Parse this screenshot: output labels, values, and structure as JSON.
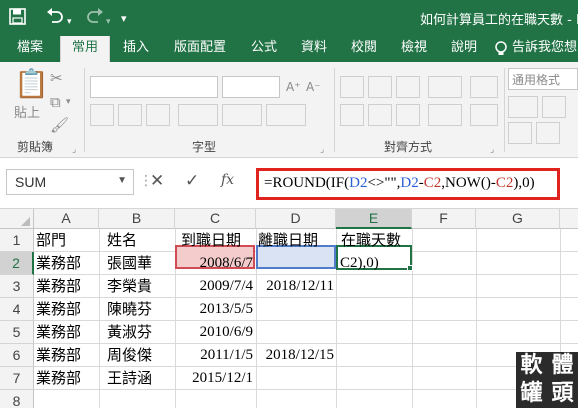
{
  "window": {
    "title": "如何計算員工的在職天數 - E",
    "save_icon": "save-icon",
    "undo_icon": "undo-icon",
    "redo_icon": "redo-icon",
    "customize_icon": "customize-quick-access-icon"
  },
  "ribbon_tabs": [
    {
      "label": "檔案"
    },
    {
      "label": "常用"
    },
    {
      "label": "插入"
    },
    {
      "label": "版面配置"
    },
    {
      "label": "公式"
    },
    {
      "label": "資料"
    },
    {
      "label": "校閱"
    },
    {
      "label": "檢視"
    },
    {
      "label": "說明"
    },
    {
      "label": "告訴我您想"
    }
  ],
  "ribbon": {
    "paste_label": "貼上",
    "groups": {
      "clipboard": "剪貼簿",
      "font": "字型",
      "alignment": "對齊方式"
    },
    "number_format": "通用格式"
  },
  "formula_bar": {
    "name_box": "SUM",
    "fx": "fx",
    "formula_parts": [
      {
        "text": "=ROUND(IF(",
        "color": "black"
      },
      {
        "text": "D2",
        "color": "blue"
      },
      {
        "text": "<>\"\",",
        "color": "black"
      },
      {
        "text": "D2",
        "color": "blue"
      },
      {
        "text": "-",
        "color": "black"
      },
      {
        "text": "C2",
        "color": "red"
      },
      {
        "text": ",NOW()-",
        "color": "black"
      },
      {
        "text": "C2",
        "color": "red"
      },
      {
        "text": "),0)",
        "color": "black"
      }
    ]
  },
  "grid": {
    "columns": [
      "A",
      "B",
      "C",
      "D",
      "E",
      "F",
      "G"
    ],
    "rows": [
      "1",
      "2",
      "3",
      "4",
      "5",
      "6",
      "7",
      "8"
    ],
    "active_column": "E",
    "active_row": "2",
    "cells": {
      "A1": "部門",
      "B1": "姓名",
      "C1": "到職日期",
      "D1": "離職日期",
      "E1": "在職天數",
      "A2": "業務部",
      "B2": "張國華",
      "C2": "2008/6/7",
      "E2": "C2),0)",
      "A3": "業務部",
      "B3": "李榮貴",
      "C3": "2009/7/4",
      "D3": "2018/12/11",
      "A4": "業務部",
      "B4": "陳曉芬",
      "C4": "2013/5/5",
      "A5": "業務部",
      "B5": "黃淑芬",
      "C5": "2010/6/9",
      "A6": "業務部",
      "B6": "周俊傑",
      "C6": "2011/1/5",
      "D6": "2018/12/15",
      "A7": "業務部",
      "B7": "王詩涵",
      "C7": "2015/12/1"
    }
  },
  "watermark": [
    "軟",
    "體",
    "罐",
    "頭"
  ]
}
